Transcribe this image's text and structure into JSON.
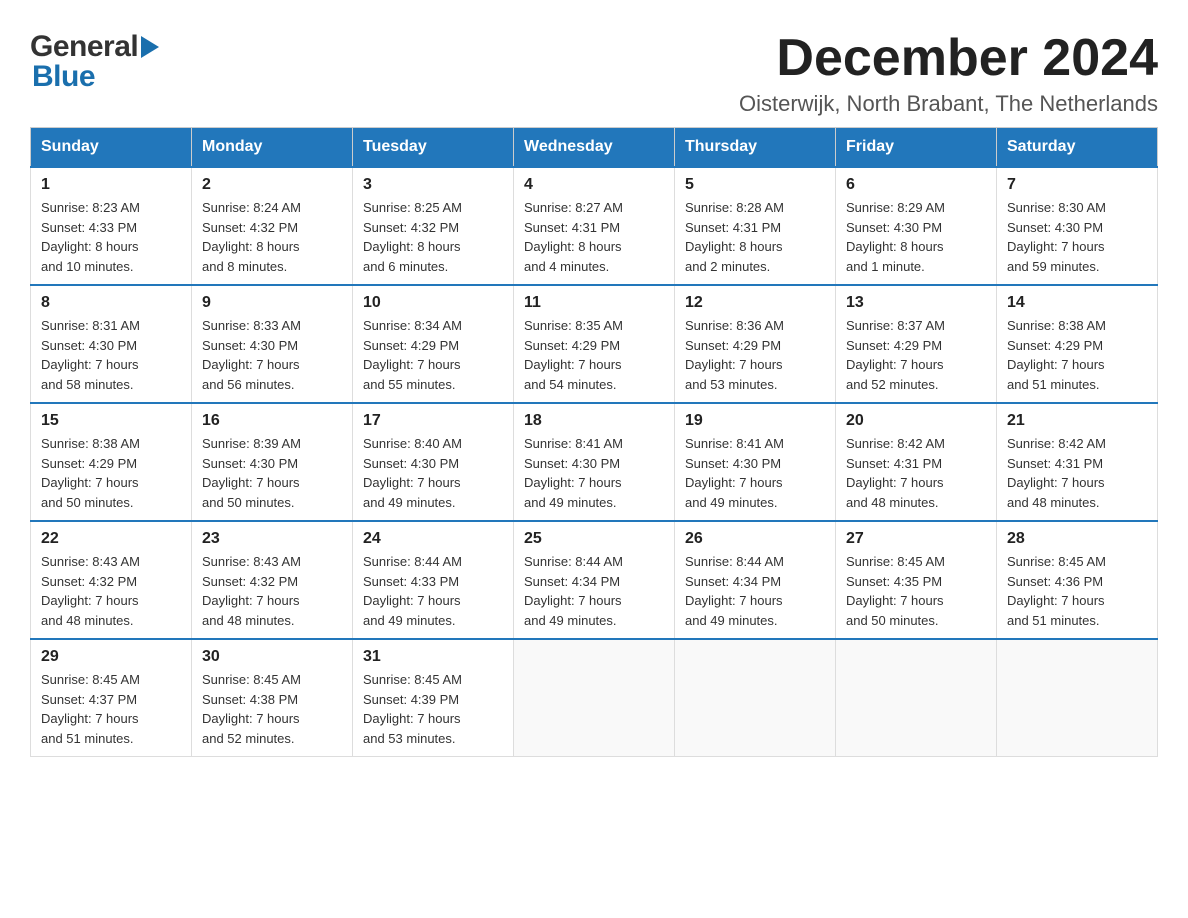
{
  "header": {
    "logo_general": "General",
    "logo_blue": "Blue",
    "month_title": "December 2024",
    "location": "Oisterwijk, North Brabant, The Netherlands"
  },
  "weekdays": [
    "Sunday",
    "Monday",
    "Tuesday",
    "Wednesday",
    "Thursday",
    "Friday",
    "Saturday"
  ],
  "weeks": [
    [
      {
        "day": "1",
        "sunrise": "8:23 AM",
        "sunset": "4:33 PM",
        "daylight": "8 hours",
        "daylight2": "and 10 minutes."
      },
      {
        "day": "2",
        "sunrise": "8:24 AM",
        "sunset": "4:32 PM",
        "daylight": "8 hours",
        "daylight2": "and 8 minutes."
      },
      {
        "day": "3",
        "sunrise": "8:25 AM",
        "sunset": "4:32 PM",
        "daylight": "8 hours",
        "daylight2": "and 6 minutes."
      },
      {
        "day": "4",
        "sunrise": "8:27 AM",
        "sunset": "4:31 PM",
        "daylight": "8 hours",
        "daylight2": "and 4 minutes."
      },
      {
        "day": "5",
        "sunrise": "8:28 AM",
        "sunset": "4:31 PM",
        "daylight": "8 hours",
        "daylight2": "and 2 minutes."
      },
      {
        "day": "6",
        "sunrise": "8:29 AM",
        "sunset": "4:30 PM",
        "daylight": "8 hours",
        "daylight2": "and 1 minute."
      },
      {
        "day": "7",
        "sunrise": "8:30 AM",
        "sunset": "4:30 PM",
        "daylight": "7 hours",
        "daylight2": "and 59 minutes."
      }
    ],
    [
      {
        "day": "8",
        "sunrise": "8:31 AM",
        "sunset": "4:30 PM",
        "daylight": "7 hours",
        "daylight2": "and 58 minutes."
      },
      {
        "day": "9",
        "sunrise": "8:33 AM",
        "sunset": "4:30 PM",
        "daylight": "7 hours",
        "daylight2": "and 56 minutes."
      },
      {
        "day": "10",
        "sunrise": "8:34 AM",
        "sunset": "4:29 PM",
        "daylight": "7 hours",
        "daylight2": "and 55 minutes."
      },
      {
        "day": "11",
        "sunrise": "8:35 AM",
        "sunset": "4:29 PM",
        "daylight": "7 hours",
        "daylight2": "and 54 minutes."
      },
      {
        "day": "12",
        "sunrise": "8:36 AM",
        "sunset": "4:29 PM",
        "daylight": "7 hours",
        "daylight2": "and 53 minutes."
      },
      {
        "day": "13",
        "sunrise": "8:37 AM",
        "sunset": "4:29 PM",
        "daylight": "7 hours",
        "daylight2": "and 52 minutes."
      },
      {
        "day": "14",
        "sunrise": "8:38 AM",
        "sunset": "4:29 PM",
        "daylight": "7 hours",
        "daylight2": "and 51 minutes."
      }
    ],
    [
      {
        "day": "15",
        "sunrise": "8:38 AM",
        "sunset": "4:29 PM",
        "daylight": "7 hours",
        "daylight2": "and 50 minutes."
      },
      {
        "day": "16",
        "sunrise": "8:39 AM",
        "sunset": "4:30 PM",
        "daylight": "7 hours",
        "daylight2": "and 50 minutes."
      },
      {
        "day": "17",
        "sunrise": "8:40 AM",
        "sunset": "4:30 PM",
        "daylight": "7 hours",
        "daylight2": "and 49 minutes."
      },
      {
        "day": "18",
        "sunrise": "8:41 AM",
        "sunset": "4:30 PM",
        "daylight": "7 hours",
        "daylight2": "and 49 minutes."
      },
      {
        "day": "19",
        "sunrise": "8:41 AM",
        "sunset": "4:30 PM",
        "daylight": "7 hours",
        "daylight2": "and 49 minutes."
      },
      {
        "day": "20",
        "sunrise": "8:42 AM",
        "sunset": "4:31 PM",
        "daylight": "7 hours",
        "daylight2": "and 48 minutes."
      },
      {
        "day": "21",
        "sunrise": "8:42 AM",
        "sunset": "4:31 PM",
        "daylight": "7 hours",
        "daylight2": "and 48 minutes."
      }
    ],
    [
      {
        "day": "22",
        "sunrise": "8:43 AM",
        "sunset": "4:32 PM",
        "daylight": "7 hours",
        "daylight2": "and 48 minutes."
      },
      {
        "day": "23",
        "sunrise": "8:43 AM",
        "sunset": "4:32 PM",
        "daylight": "7 hours",
        "daylight2": "and 48 minutes."
      },
      {
        "day": "24",
        "sunrise": "8:44 AM",
        "sunset": "4:33 PM",
        "daylight": "7 hours",
        "daylight2": "and 49 minutes."
      },
      {
        "day": "25",
        "sunrise": "8:44 AM",
        "sunset": "4:34 PM",
        "daylight": "7 hours",
        "daylight2": "and 49 minutes."
      },
      {
        "day": "26",
        "sunrise": "8:44 AM",
        "sunset": "4:34 PM",
        "daylight": "7 hours",
        "daylight2": "and 49 minutes."
      },
      {
        "day": "27",
        "sunrise": "8:45 AM",
        "sunset": "4:35 PM",
        "daylight": "7 hours",
        "daylight2": "and 50 minutes."
      },
      {
        "day": "28",
        "sunrise": "8:45 AM",
        "sunset": "4:36 PM",
        "daylight": "7 hours",
        "daylight2": "and 51 minutes."
      }
    ],
    [
      {
        "day": "29",
        "sunrise": "8:45 AM",
        "sunset": "4:37 PM",
        "daylight": "7 hours",
        "daylight2": "and 51 minutes."
      },
      {
        "day": "30",
        "sunrise": "8:45 AM",
        "sunset": "4:38 PM",
        "daylight": "7 hours",
        "daylight2": "and 52 minutes."
      },
      {
        "day": "31",
        "sunrise": "8:45 AM",
        "sunset": "4:39 PM",
        "daylight": "7 hours",
        "daylight2": "and 53 minutes."
      },
      null,
      null,
      null,
      null
    ]
  ]
}
